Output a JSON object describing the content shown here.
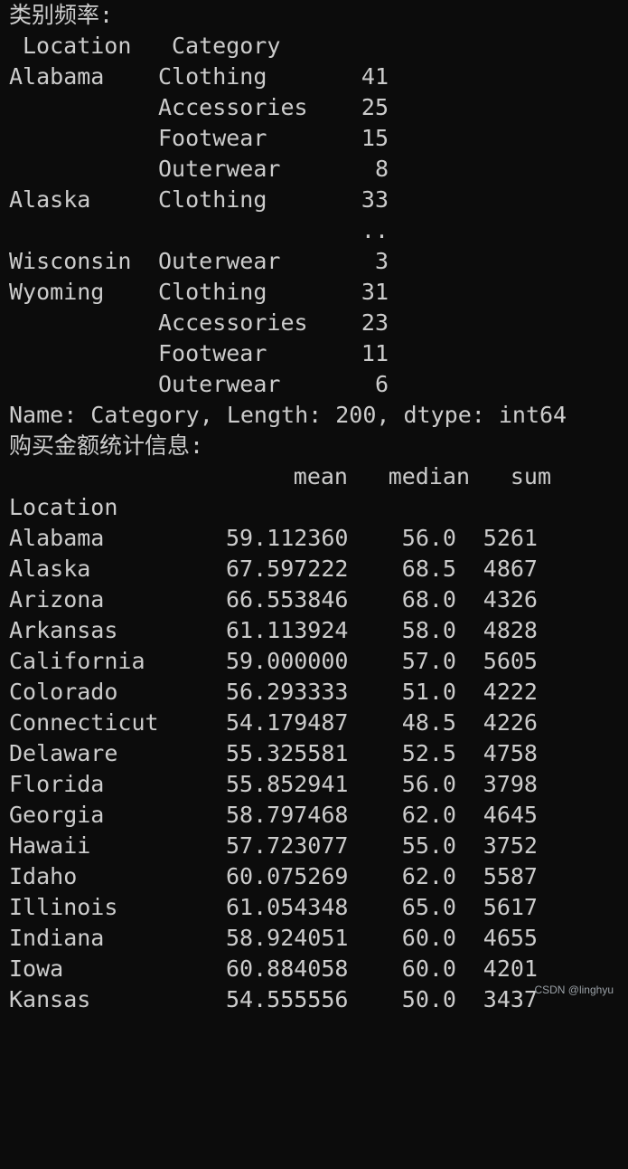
{
  "section1": {
    "heading": "类别频率:",
    "header": [
      "Location",
      "Category"
    ],
    "rows": [
      {
        "location": "Alabama",
        "category": "Clothing",
        "value": "41"
      },
      {
        "location": "",
        "category": "Accessories",
        "value": "25"
      },
      {
        "location": "",
        "category": "Footwear",
        "value": "15"
      },
      {
        "location": "",
        "category": "Outerwear",
        "value": "8"
      },
      {
        "location": "Alaska",
        "category": "Clothing",
        "value": "33"
      },
      {
        "location": "",
        "category": "",
        "value": ".."
      },
      {
        "location": "Wisconsin",
        "category": "Outerwear",
        "value": "3"
      },
      {
        "location": "Wyoming",
        "category": "Clothing",
        "value": "31"
      },
      {
        "location": "",
        "category": "Accessories",
        "value": "23"
      },
      {
        "location": "",
        "category": "Footwear",
        "value": "11"
      },
      {
        "location": "",
        "category": "Outerwear",
        "value": "6"
      }
    ],
    "footer": "Name: Category, Length: 200, dtype: int64"
  },
  "section2": {
    "heading": "购买金额统计信息:",
    "columns": [
      "mean",
      "median",
      "sum"
    ],
    "index_name": "Location",
    "rows": [
      {
        "location": "Alabama",
        "mean": "59.112360",
        "median": "56.0",
        "sum": "5261"
      },
      {
        "location": "Alaska",
        "mean": "67.597222",
        "median": "68.5",
        "sum": "4867"
      },
      {
        "location": "Arizona",
        "mean": "66.553846",
        "median": "68.0",
        "sum": "4326"
      },
      {
        "location": "Arkansas",
        "mean": "61.113924",
        "median": "58.0",
        "sum": "4828"
      },
      {
        "location": "California",
        "mean": "59.000000",
        "median": "57.0",
        "sum": "5605"
      },
      {
        "location": "Colorado",
        "mean": "56.293333",
        "median": "51.0",
        "sum": "4222"
      },
      {
        "location": "Connecticut",
        "mean": "54.179487",
        "median": "48.5",
        "sum": "4226"
      },
      {
        "location": "Delaware",
        "mean": "55.325581",
        "median": "52.5",
        "sum": "4758"
      },
      {
        "location": "Florida",
        "mean": "55.852941",
        "median": "56.0",
        "sum": "3798"
      },
      {
        "location": "Georgia",
        "mean": "58.797468",
        "median": "62.0",
        "sum": "4645"
      },
      {
        "location": "Hawaii",
        "mean": "57.723077",
        "median": "55.0",
        "sum": "3752"
      },
      {
        "location": "Idaho",
        "mean": "60.075269",
        "median": "62.0",
        "sum": "5587"
      },
      {
        "location": "Illinois",
        "mean": "61.054348",
        "median": "65.0",
        "sum": "5617"
      },
      {
        "location": "Indiana",
        "mean": "58.924051",
        "median": "60.0",
        "sum": "4655"
      },
      {
        "location": "Iowa",
        "mean": "60.884058",
        "median": "60.0",
        "sum": "4201"
      },
      {
        "location": "Kansas",
        "mean": "54.555556",
        "median": "50.0",
        "sum": "3437"
      }
    ]
  },
  "watermark": "CSDN @linghyu"
}
